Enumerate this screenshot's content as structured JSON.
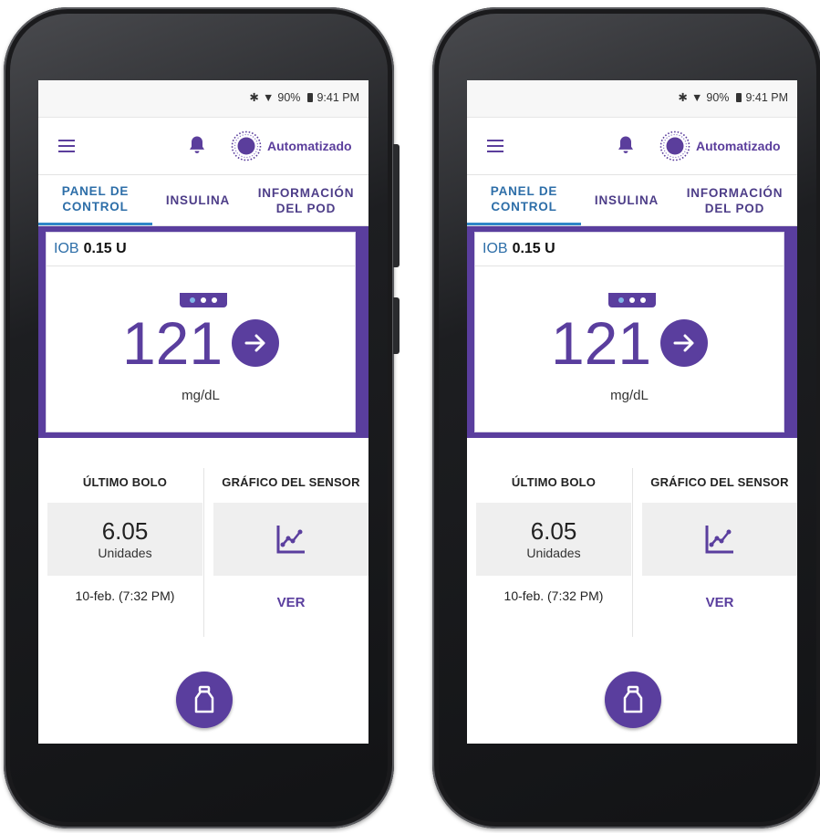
{
  "screens": [
    {
      "status": {
        "time": "9:41 PM",
        "battery": "90%"
      },
      "appbar": {
        "mode_label": "Automatizado"
      },
      "tabs": [
        {
          "label": "PANEL DE\nCONTROL",
          "active": true
        },
        {
          "label": "INSULINA",
          "active": false
        },
        {
          "label": "INFORMACIÓN\nDEL POD",
          "active": false
        }
      ],
      "iob": {
        "label": "IOB",
        "value": "0.15 U"
      },
      "glucose": {
        "value": "121",
        "unit": "mg/dL"
      },
      "page_indicator": {
        "count": 3,
        "active_index": 0
      },
      "last_bolus": {
        "title": "ÚLTIMO BOLO",
        "amount": "6.05",
        "unit": "Unidades",
        "time": "10-feb. (7:32 PM)"
      },
      "sensor_graph": {
        "title": "GRÁFICO DEL SENSOR",
        "action": "VER"
      }
    },
    {
      "status": {
        "time": "9:41 PM",
        "battery": "90%"
      },
      "appbar": {
        "mode_label": "Automatizado"
      },
      "tabs": [
        {
          "label": "PANEL DE\nCONTROL",
          "active": true
        },
        {
          "label": "INSULINA",
          "active": false
        },
        {
          "label": "INFORMACIÓN\nDEL POD",
          "active": false
        }
      ],
      "iob": {
        "label": "IOB",
        "value": "0.15 U"
      },
      "glucose": {
        "value": "121",
        "unit": "mg/dL"
      },
      "page_indicator": {
        "count": 3,
        "active_index": 0
      },
      "last_bolus": {
        "title": "ÚLTIMO BOLO",
        "amount": "6.05",
        "unit": "Unidades",
        "time": "10-feb. (7:32 PM)"
      },
      "sensor_graph": {
        "title": "GRÁFICO DEL SENSOR",
        "action": "VER"
      }
    }
  ],
  "colors": {
    "brand_purple": "#5a3e9e",
    "tab_active_blue": "#2f86c8",
    "screen_bg": "#ffffff"
  },
  "icons": [
    "menu-icon",
    "bell-icon",
    "automated-mode-icon",
    "trend-arrow-right-icon",
    "sensor-graph-icon",
    "bolus-vial-icon",
    "bluetooth-icon",
    "wifi-icon",
    "battery-icon"
  ]
}
